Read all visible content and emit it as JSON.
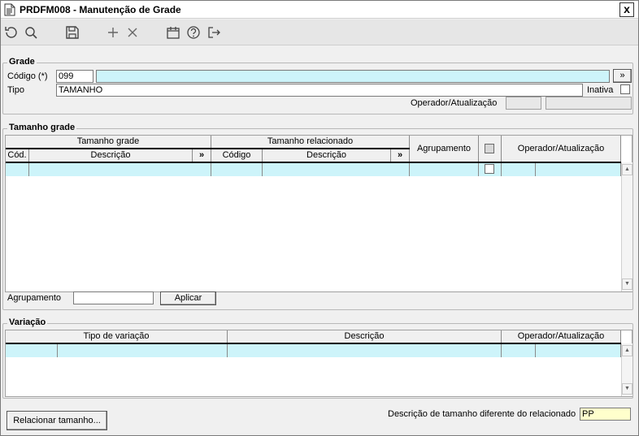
{
  "window": {
    "title": "PRDFM008 - Manutenção de Grade",
    "close_label": "x"
  },
  "toolbar": {
    "icons": [
      "undo-icon",
      "search-icon",
      "save-icon",
      "add-icon",
      "delete-icon",
      "calendar-icon",
      "help-icon",
      "exit-icon"
    ]
  },
  "grade": {
    "title": "Grade",
    "codigo_label": "Código (*)",
    "codigo_value": "099",
    "codigo_desc": "",
    "tipo_label": "Tipo",
    "tipo_value": "TAMANHO",
    "inativa_label": "Inativa",
    "operador_label": "Operador/Atualização",
    "more_button": "»"
  },
  "tamanho_grade": {
    "title": "Tamanho grade",
    "group_tamanho_grade": "Tamanho grade",
    "group_tamanho_relacionado": "Tamanho relacionado",
    "col_cod": "Cód.",
    "col_descricao": "Descrição",
    "col_codigo": "Código",
    "col_descricao2": "Descrição",
    "col_agrupamento": "Agrupamento",
    "col_operador": "Operador/Atualização",
    "more1": "»",
    "more2": "»",
    "agrupamento_label": "Agrupamento",
    "agrupamento_value": "",
    "aplicar_label": "Aplicar"
  },
  "variacao": {
    "title": "Variação",
    "col_tipo": "Tipo de variação",
    "col_descricao": "Descrição",
    "col_operador": "Operador/Atualização"
  },
  "footer": {
    "relacionar_label": "Relacionar tamanho...",
    "desc_diferente_label": "Descrição de tamanho diferente do relacionado",
    "desc_diferente_value": "PP"
  }
}
